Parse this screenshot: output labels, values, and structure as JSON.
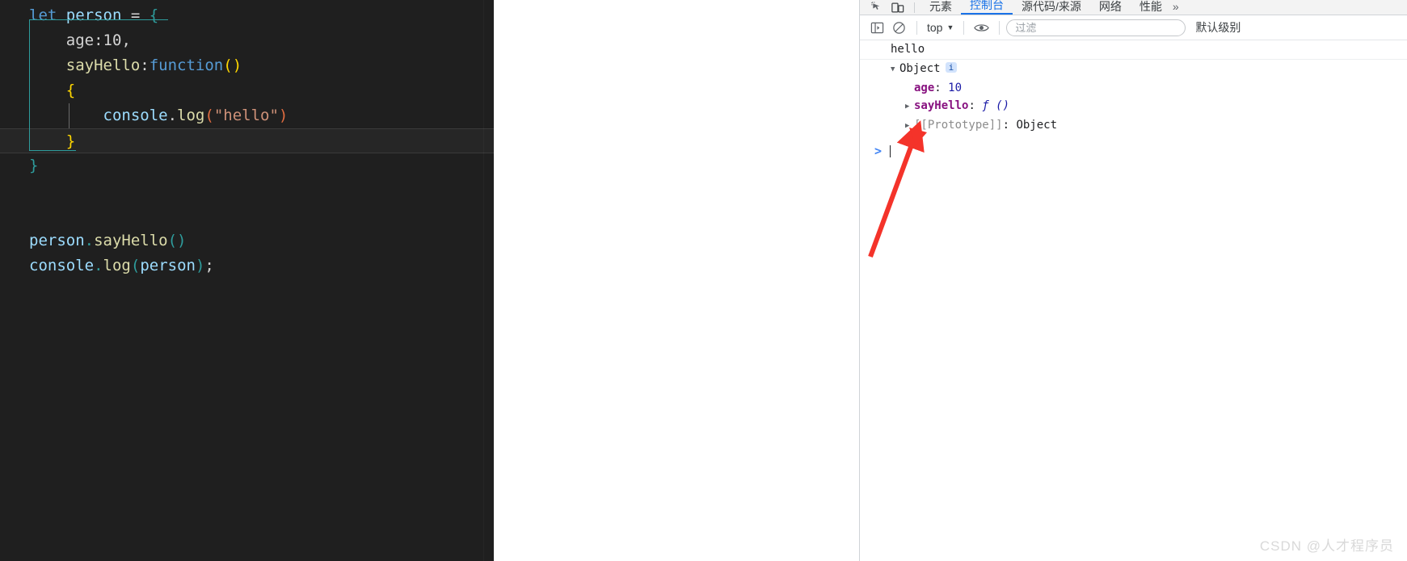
{
  "editor": {
    "language": "javascript",
    "lines": [
      {
        "id": "line-0-partial",
        "partial": true,
        "tokens": []
      },
      {
        "id": "line-let-person",
        "tokens": [
          {
            "t": "let",
            "c": "t-key"
          },
          {
            "t": " ",
            "c": "t-plain"
          },
          {
            "t": "person",
            "c": "t-var"
          },
          {
            "t": " ",
            "c": "t-plain"
          },
          {
            "t": "=",
            "c": "t-plain"
          },
          {
            "t": " ",
            "c": "t-plain"
          },
          {
            "t": "{",
            "c": "t-teal"
          }
        ]
      },
      {
        "id": "line-age",
        "tokens": [
          {
            "t": "    ",
            "c": "t-plain"
          },
          {
            "t": "age",
            "c": "t-prop"
          },
          {
            "t": ":",
            "c": "t-plain"
          },
          {
            "t": "10",
            "c": "t-prop"
          },
          {
            "t": ",",
            "c": "t-plain"
          }
        ]
      },
      {
        "id": "line-sayhello-def",
        "tokens": [
          {
            "t": "    ",
            "c": "t-plain"
          },
          {
            "t": "sayHello",
            "c": "t-fn"
          },
          {
            "t": ":",
            "c": "t-plain"
          },
          {
            "t": "function",
            "c": "t-key"
          },
          {
            "t": "()",
            "c": "t-yellow"
          }
        ]
      },
      {
        "id": "line-open-brace",
        "tokens": [
          {
            "t": "    ",
            "c": "t-plain"
          },
          {
            "t": "{",
            "c": "t-yellow"
          }
        ]
      },
      {
        "id": "line-console-log-hello",
        "tokens": [
          {
            "t": "        ",
            "c": "t-plain"
          },
          {
            "t": "console",
            "c": "t-var"
          },
          {
            "t": ".",
            "c": "t-plain"
          },
          {
            "t": "log",
            "c": "t-fn"
          },
          {
            "t": "(",
            "c": "t-red"
          },
          {
            "t": "\"hello\"",
            "c": "t-str"
          },
          {
            "t": ")",
            "c": "t-red"
          }
        ]
      },
      {
        "id": "line-close-brace-fn",
        "highlight": true,
        "tokens": [
          {
            "t": "    ",
            "c": "t-plain"
          },
          {
            "t": "}",
            "c": "t-yellow"
          }
        ]
      },
      {
        "id": "line-close-brace-obj",
        "tokens": [
          {
            "t": "}",
            "c": "t-teal"
          }
        ]
      },
      {
        "id": "line-blank-1",
        "tokens": []
      },
      {
        "id": "line-blank-2",
        "tokens": []
      },
      {
        "id": "line-call-sayhello",
        "tokens": [
          {
            "t": "person",
            "c": "t-var"
          },
          {
            "t": ".",
            "c": "t-teal"
          },
          {
            "t": "sayHello",
            "c": "t-fn"
          },
          {
            "t": "()",
            "c": "t-teal"
          }
        ]
      },
      {
        "id": "line-console-log-person",
        "tokens": [
          {
            "t": "console",
            "c": "t-var"
          },
          {
            "t": ".",
            "c": "t-teal"
          },
          {
            "t": "log",
            "c": "t-fn"
          },
          {
            "t": "(",
            "c": "t-teal"
          },
          {
            "t": "person",
            "c": "t-var"
          },
          {
            "t": ")",
            "c": "t-teal"
          },
          {
            "t": ";",
            "c": "t-plain"
          }
        ]
      }
    ]
  },
  "devtools": {
    "tabs": [
      {
        "id": "tab-elements",
        "label": "元素",
        "active": false
      },
      {
        "id": "tab-console",
        "label": "控制台",
        "active": true
      },
      {
        "id": "tab-sources",
        "label": "源代码/来源",
        "active": false
      },
      {
        "id": "tab-network",
        "label": "网络",
        "active": false
      },
      {
        "id": "tab-performance",
        "label": "性能",
        "active": false
      }
    ],
    "more_tabs_label": "»",
    "toolbar": {
      "sidebar_toggle_icon": "panel-toggle-icon",
      "clear_console_icon": "clear-console-icon",
      "context_label": "top",
      "context_caret": "▼",
      "eye_icon": "eye-icon",
      "filter_placeholder": "过滤",
      "filter_value": "",
      "level_label": "默认级别",
      "level_caret": "▼"
    },
    "console": {
      "messages": [
        {
          "id": "msg-hello",
          "type": "log",
          "text": "hello"
        }
      ],
      "object": {
        "disclosure": "▼",
        "label": "Object",
        "info_badge": "i",
        "properties": [
          {
            "id": "prop-age",
            "disclosure": "",
            "name": "age",
            "dim": false,
            "separator": ": ",
            "value": "10",
            "value_kind": "number"
          },
          {
            "id": "prop-sayhello",
            "disclosure": "▶",
            "name": "sayHello",
            "dim": false,
            "separator": ": ",
            "value": "ƒ ()",
            "value_kind": "function"
          },
          {
            "id": "prop-prototype",
            "disclosure": "▶",
            "name": "[[Prototype]]",
            "dim": true,
            "separator": ": ",
            "value": "Object",
            "value_kind": "object"
          }
        ]
      },
      "prompt": {
        "caret": ">",
        "value": ""
      }
    }
  },
  "annotation": {
    "arrow_color": "#f4332a",
    "arrow_name": "red-pointer-arrow",
    "points_at": "prop-prototype"
  },
  "watermark": {
    "text": "CSDN @人才程序员"
  }
}
